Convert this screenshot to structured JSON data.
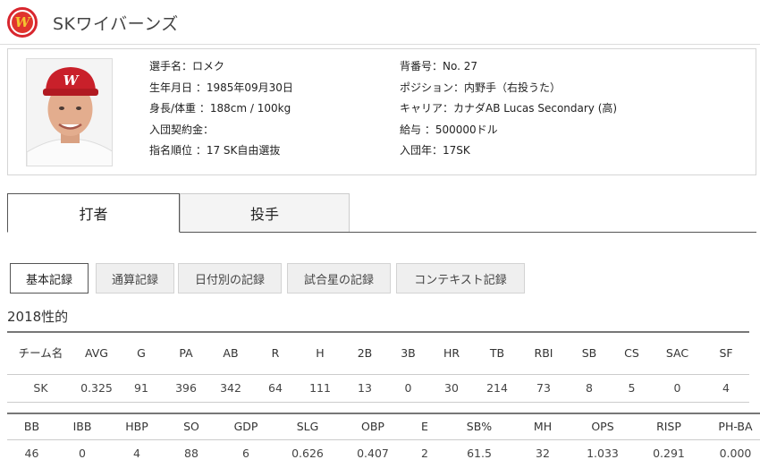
{
  "header": {
    "team_name": "SKワイバーンズ",
    "logo_letter": "W"
  },
  "profile": {
    "left": [
      {
        "label": "選手名：ロメク"
      },
      {
        "label": "生年月日 ：1985年09月30日"
      },
      {
        "label": "身長/体重 ：188cm / 100kg"
      },
      {
        "label": "入団契約金："
      },
      {
        "label": "指名順位 ：17 SK自由選抜"
      }
    ],
    "right": [
      {
        "label": "背番号：No. 27"
      },
      {
        "label": "ポジション：内野手（右投うた）"
      },
      {
        "label": "キャリア：カナダAB Lucas Secondary (高)"
      },
      {
        "label": "給与 ：500000ドル"
      },
      {
        "label": "入団年：17SK"
      }
    ]
  },
  "tabs": {
    "batter": "打者",
    "pitcher": "投手"
  },
  "subtabs": [
    "基本記録",
    "通算記録",
    "日付別の記録",
    "試合星の記録",
    "コンテキスト記録"
  ],
  "section_title": "2018性的",
  "table1": {
    "headers": [
      "チーム名",
      "AVG",
      "G",
      "PA",
      "AB",
      "R",
      "H",
      "2B",
      "3B",
      "HR",
      "TB",
      "RBI",
      "SB",
      "CS",
      "SAC",
      "SF"
    ],
    "row": [
      "SK",
      "0.325",
      "91",
      "396",
      "342",
      "64",
      "111",
      "13",
      "0",
      "30",
      "214",
      "73",
      "8",
      "5",
      "0",
      "4"
    ]
  },
  "table2": {
    "headers": [
      "BB",
      "IBB",
      "HBP",
      "SO",
      "GDP",
      "SLG",
      "OBP",
      "E",
      "SB%",
      "MH",
      "OPS",
      "RISP",
      "PH-BA"
    ],
    "row": [
      "46",
      "0",
      "4",
      "88",
      "6",
      "0.626",
      "0.407",
      "2",
      "61.5",
      "32",
      "1.033",
      "0.291",
      "0.000"
    ]
  },
  "colors": {
    "team_red": "#d8262e",
    "logo_gold": "#f4c430"
  }
}
